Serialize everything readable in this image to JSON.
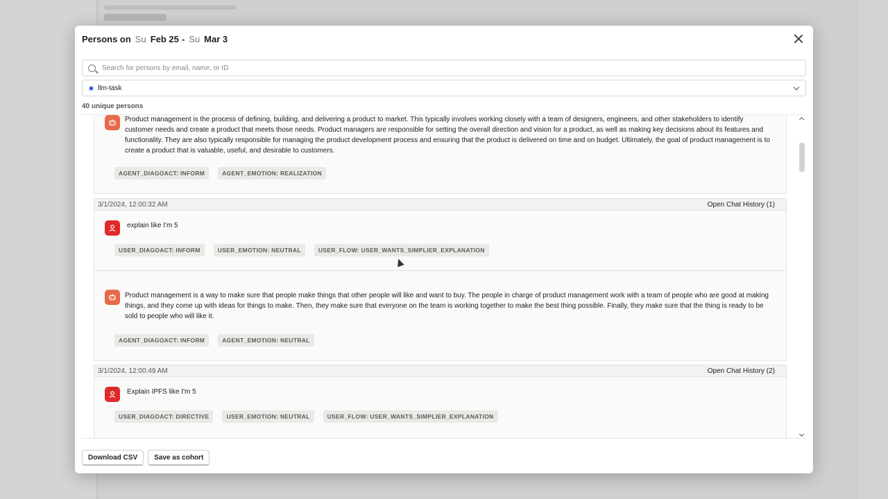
{
  "modal": {
    "title_prefix": "Persons on",
    "start_dow": "Su",
    "start_date": "Feb 25",
    "separator": "-",
    "end_dow": "Su",
    "end_date": "Mar 3"
  },
  "search": {
    "placeholder": "Search for persons by email, name, or ID",
    "value": ""
  },
  "filter": {
    "selected": "llm-task"
  },
  "persons_count": "40 unique persons",
  "conversation": [
    {
      "role": "agent",
      "text": "Product management is the process of defining, building, and delivering a product to market. This typically involves working closely with a team of designers, engineers, and other stakeholders to identify customer needs and create a product that meets those needs. Product managers are responsible for setting the overall direction and vision for a product, as well as making key decisions about its features and functionality. They are also typically responsible for managing the product development process and ensuring that the product is delivered on time and on budget. Ultimately, the goal of product management is to create a product that is valuable, useful, and desirable to customers.",
      "tags": [
        "AGENT_DIAGOACT: INFORM",
        "AGENT_EMOTION: REALIZATION"
      ]
    },
    {
      "timestamp": "3/1/2024, 12:00:32 AM",
      "history_link": "Open Chat History (1)",
      "role": "user",
      "text": "explain like I'm 5",
      "tags": [
        "USER_DIAGOACT: INFORM",
        "USER_EMOTION: NEUTRAL",
        "USER_FLOW: USER_WANTS_SIMPLIER_EXPLANATION"
      ]
    },
    {
      "role": "agent",
      "text": "Product management is a way to make sure that people make things that other people will like and want to buy. The people in charge of product management work with a team of people who are good at making things, and they come up with ideas for things to make. Then, they make sure that everyone on the team is working together to make the best thing possible. Finally, they make sure that the thing is ready to be sold to people who will like it.",
      "tags": [
        "AGENT_DIAGOACT: INFORM",
        "AGENT_EMOTION: NEUTRAL"
      ]
    },
    {
      "timestamp": "3/1/2024, 12:00:49 AM",
      "history_link": "Open Chat History (2)",
      "role": "user",
      "text": "Explain IPFS like I'm 5",
      "tags": [
        "USER_DIAGOACT: DIRECTIVE",
        "USER_EMOTION: NEUTRAL",
        "USER_FLOW: USER_WANTS_SIMPLIER_EXPLANATION"
      ]
    }
  ],
  "footer": {
    "download_label": "Download CSV",
    "cohort_label": "Save as cohort"
  },
  "icons": {
    "close": "close-icon",
    "search": "search-icon",
    "dropdown": "chevron-down-icon",
    "agent": "robot-icon",
    "user": "user-icon"
  },
  "colors": {
    "avatar_user": "#e02a2a",
    "avatar_agent": "#e86a4a",
    "radio": "#1f4fd8"
  }
}
